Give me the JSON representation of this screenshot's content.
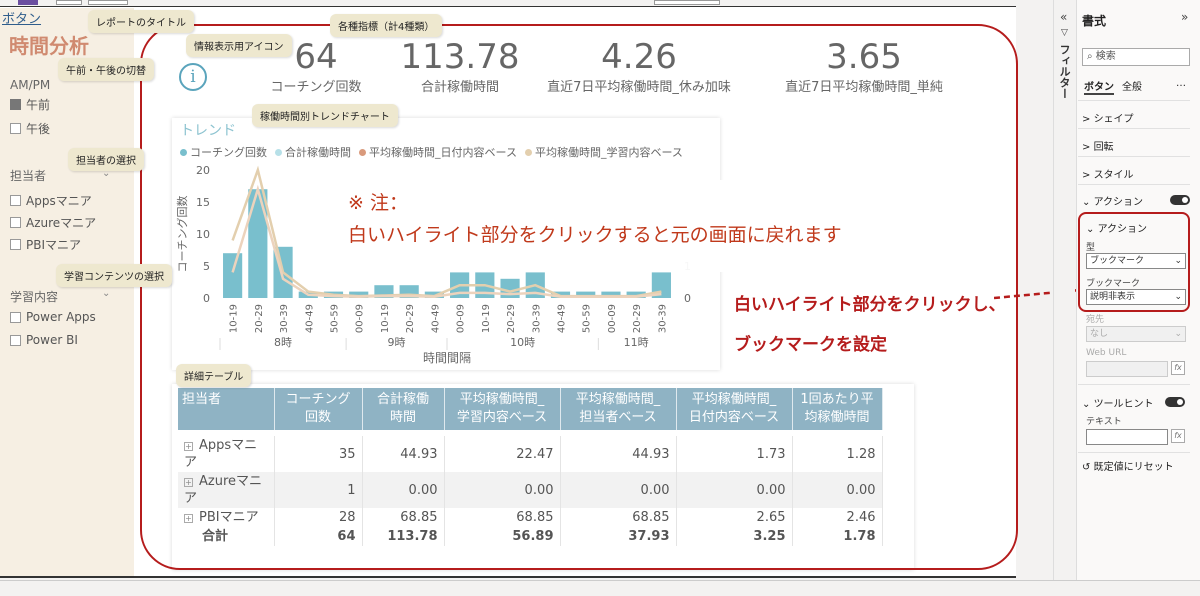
{
  "report": {
    "button_link": "ボタン",
    "page_title": "時間分析"
  },
  "slicers": {
    "ampm": {
      "header": "AM/PM",
      "items": [
        "午前",
        "午後"
      ]
    },
    "person": {
      "header": "担当者",
      "items": [
        "Appsマニア",
        "Azureマニア",
        "PBIマニア"
      ]
    },
    "content": {
      "header": "学習内容",
      "items": [
        "Power Apps",
        "Power BI"
      ]
    }
  },
  "callouts": {
    "title": "レポートのタイトル",
    "kpis": "各種指標（計4種類）",
    "info": "情報表示用アイコン",
    "ampm": "午前・午後の切替",
    "person": "担当者の選択",
    "content": "学習コンテンツの選択",
    "trend": "稼働時間別トレンドチャート",
    "table": "詳細テーブル"
  },
  "info_icon": "i",
  "kpis": [
    {
      "value": "64",
      "label": "コーチング回数"
    },
    {
      "value": "113.78",
      "label": "合計稼働時間"
    },
    {
      "value": "4.26",
      "label": "直近7日平均稼働時間_休み加味"
    },
    {
      "value": "3.65",
      "label": "直近7日平均稼働時間_単純"
    }
  ],
  "chart_data": {
    "type": "bar",
    "title": "トレンド",
    "legend": [
      {
        "name": "コーチング回数",
        "color": "#79bfcd"
      },
      {
        "name": "合計稼働時間",
        "color": "#b7e0e8"
      },
      {
        "name": "平均稼働時間_日付内容ベース",
        "color": "#d99a7c"
      },
      {
        "name": "平均稼働時間_学習内容ベース",
        "color": "#e3cfae"
      }
    ],
    "categories": [
      "10-19",
      "20-29",
      "30-39",
      "40-49",
      "50-59",
      "00-09",
      "10-19",
      "20-29",
      "40-49",
      "00-09",
      "10-19",
      "20-29",
      "30-39",
      "40-49",
      "50-59",
      "00-09",
      "20-29",
      "30-39"
    ],
    "groups": [
      {
        "label": "8時",
        "from": 0,
        "to": 4
      },
      {
        "label": "9時",
        "from": 5,
        "to": 8
      },
      {
        "label": "10時",
        "from": 9,
        "to": 14
      },
      {
        "label": "11時",
        "from": 15,
        "to": 17
      }
    ],
    "bar_series": {
      "name": "コーチング回数",
      "values": [
        7,
        17,
        8,
        1,
        1,
        1,
        2,
        2,
        1,
        4,
        4,
        3,
        4,
        1,
        1,
        1,
        1,
        4
      ]
    },
    "line_series": [
      {
        "name": "平均稼働時間_学習内容ベース",
        "values": [
          9,
          20,
          4,
          1,
          0.5,
          0.3,
          0.4,
          0.5,
          0.3,
          2,
          2,
          1,
          2,
          0.3,
          0.3,
          0.3,
          0.3,
          1
        ]
      },
      {
        "name": "平均稼働時間_日付内容ベース",
        "values": [
          4,
          17,
          3,
          0.5,
          0.3,
          0.2,
          0.3,
          0.3,
          0.2,
          0.8,
          0.8,
          0.6,
          0.8,
          0.2,
          0.2,
          0.2,
          0.2,
          0.6
        ]
      }
    ],
    "ylabel": "コーチング回数",
    "xlabel": "時間間隔",
    "ylim": [
      0,
      20
    ],
    "yticks": [
      0,
      5,
      10,
      15,
      20
    ],
    "y2_ticks": [
      "0",
      "1",
      "2"
    ]
  },
  "note": {
    "title": "※ 注：",
    "body": "白いハイライト部分をクリックすると元の画面に戻れます"
  },
  "table": {
    "headers": [
      "担当者",
      "コーチング回数",
      "合計稼働時間",
      "平均稼働時間_学習内容ベース",
      "平均稼働時間_担当者ベース",
      "平均稼働時間_日付内容ベース",
      "1回あたり平均稼働時間"
    ],
    "header_lines": [
      [
        "担当者"
      ],
      [
        "コーチング",
        "回数"
      ],
      [
        "合計稼働",
        "時間"
      ],
      [
        "平均稼働時間_",
        "学習内容ベース"
      ],
      [
        "平均稼働時間_",
        "担当者ベース"
      ],
      [
        "平均稼働時間_",
        "日付内容ベース"
      ],
      [
        "1回あたり平",
        "均稼働時間"
      ]
    ],
    "rows": [
      [
        "Appsマニア",
        "35",
        "44.93",
        "22.47",
        "44.93",
        "1.73",
        "1.28"
      ],
      [
        "Azureマニア",
        "1",
        "0.00",
        "0.00",
        "0.00",
        "0.00",
        "0.00"
      ],
      [
        "PBIマニア",
        "28",
        "68.85",
        "68.85",
        "68.85",
        "2.65",
        "2.46"
      ]
    ],
    "total": [
      "合計",
      "64",
      "113.78",
      "56.89",
      "37.93",
      "3.25",
      "1.78"
    ]
  },
  "annotations": {
    "click_set": "白いハイライト部分をクリックし、",
    "bookmark_set": "ブックマークを設定"
  },
  "format_pane": {
    "title": "書式",
    "filter_label": "フィルター",
    "search_placeholder": "検索",
    "tabs": [
      "ボタン",
      "全般"
    ],
    "more": "…",
    "sections": [
      "シェイプ",
      "回転",
      "スタイル",
      "アクション",
      "ツールヒント"
    ],
    "action": {
      "header": "アクション",
      "type_label": "型",
      "type_value": "ブックマーク",
      "bookmark_label": "ブックマーク",
      "bookmark_value": "説明非表示",
      "dest_label": "宛先",
      "dest_value": "なし",
      "url_label": "Web URL"
    },
    "tooltip": {
      "text_label": "テキスト"
    },
    "fx": "fx",
    "reset": "既定値にリセット"
  }
}
